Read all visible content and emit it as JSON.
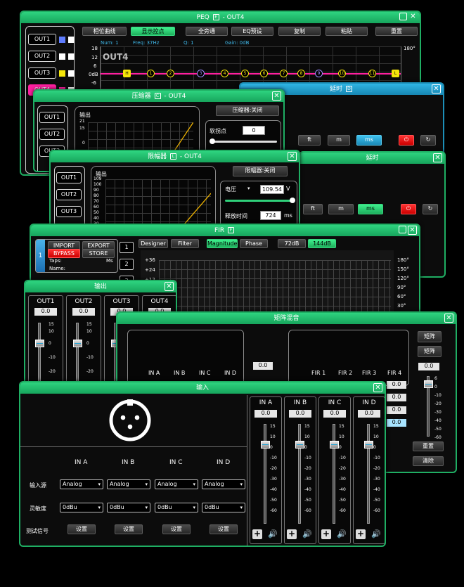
{
  "peq": {
    "title": "PEQ",
    "title_suffix": "- OUT4",
    "title_icon": "E",
    "toolbar": [
      "相位曲线",
      "显示控点",
      "全旁通",
      "EQ预设",
      "复制",
      "粘贴",
      "重置"
    ],
    "outputs": [
      "OUT1",
      "OUT2",
      "OUT3",
      "OUT4"
    ],
    "info": {
      "num": "Num: 1",
      "freq": "Freq: 37Hz",
      "q": "Q: 1",
      "gain": "Gain: 0dB"
    },
    "y_ticks": [
      "18",
      "12",
      "6",
      "0dB",
      "-6"
    ],
    "right_tick": "180°",
    "graph_label": "OUT4",
    "nodes": [
      "H",
      "1",
      "2",
      "3",
      "4",
      "5",
      "6",
      "7",
      "8",
      "9",
      "10",
      "11",
      "L"
    ],
    "colors": {
      "blue": "#5f7dff",
      "yellow": "#f5e60a",
      "magenta": "#ff1fa0",
      "white": "#ffffff"
    }
  },
  "delay_top": {
    "title": "延时",
    "title_icon": "D",
    "units": [
      "ft",
      "m",
      "ms"
    ]
  },
  "delay_mid": {
    "title": "延时",
    "units": [
      "ft",
      "m",
      "ms"
    ]
  },
  "compressor": {
    "title": "压缩器",
    "title_icon": "C",
    "title_suffix": "- OUT4",
    "outputs": [
      "OUT1",
      "OUT2",
      "OUT3"
    ],
    "plot_label": "输出",
    "y_ticks": [
      "21",
      "15",
      "0"
    ],
    "toggle": "压缩器:关闭",
    "knee_label": "软拐点",
    "knee_value": "0"
  },
  "limiter": {
    "title": "限幅器",
    "title_icon": "L",
    "title_suffix": "- OUT4",
    "outputs": [
      "OUT1",
      "OUT2",
      "OUT3"
    ],
    "plot_label": "输出",
    "y_ticks": [
      "109",
      "100",
      "90",
      "80",
      "70",
      "60",
      "50",
      "40",
      "30",
      "20",
      "10"
    ],
    "toggle": "限幅器:关闭",
    "voltage_label": "电压",
    "voltage_value": "109.54",
    "voltage_unit": "V",
    "release_label": "释放时间",
    "release_value": "724",
    "release_unit": "ms"
  },
  "fir": {
    "title": "FIR",
    "title_icon": "F",
    "import": "IMPORT",
    "export": "EXPORT",
    "bypass": "BYPASS",
    "store": "STORE",
    "taps": "Taps:",
    "taps_unit": "Ms",
    "name": "Name:",
    "channel": "1",
    "channels": [
      "1",
      "2",
      "3"
    ],
    "tabs": [
      "Designer",
      "Filter",
      "Magnitude",
      "Phase"
    ],
    "db": [
      "72dB",
      "144dB"
    ],
    "y_ticks": [
      "+36",
      "+24",
      "+12"
    ],
    "r_ticks": [
      "180°",
      "150°",
      "120°",
      "90°",
      "60°",
      "30°"
    ]
  },
  "output": {
    "title": "输出",
    "channels": [
      "OUT1",
      "OUT2",
      "OUT3",
      "OUT4"
    ],
    "value": "0.0",
    "ticks": [
      "15",
      "10",
      "0",
      "-10",
      "-20"
    ]
  },
  "matrix": {
    "title": "矩阵混音",
    "inputs": [
      "IN A",
      "IN B",
      "IN C",
      "IN D"
    ],
    "firs": [
      "FIR 1",
      "FIR 2",
      "FIR 3",
      "FIR 4"
    ],
    "right_buttons": [
      "矩阵",
      "矩阵"
    ],
    "values": [
      "0.0",
      "0.0",
      "0.0",
      "0.0",
      "0.0",
      "0.0"
    ],
    "fader_ticks": [
      "6",
      "0",
      "-10",
      "-20",
      "-30",
      "-40",
      "-50",
      "-60"
    ],
    "reset": "重置",
    "clear": "清除"
  },
  "input": {
    "title": "输入",
    "channels": [
      "IN A",
      "IN B",
      "IN C",
      "IN D"
    ],
    "row_labels": {
      "source": "输入源",
      "sensitivity": "灵敏度",
      "test": "测试信号"
    },
    "source_value": "Analog",
    "sensitivity_value": "0dBu",
    "test_button": "设置",
    "fader_value": "0.0",
    "fader_ticks": [
      "15",
      "10",
      "0",
      "-10",
      "-20",
      "-30",
      "-40",
      "-50",
      "-60"
    ]
  }
}
